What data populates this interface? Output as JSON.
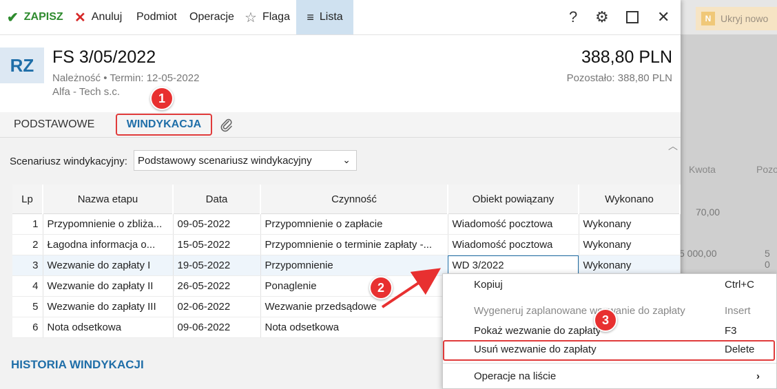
{
  "toolbar": {
    "save": "ZAPISZ",
    "cancel": "Anuluj",
    "podmiot": "Podmiot",
    "operacje": "Operacje",
    "flaga": "Flaga",
    "lista": "Lista"
  },
  "header": {
    "badge": "RZ",
    "title": "FS 3/05/2022",
    "subtitle": "Należność  •  Termin: 12-05-2022",
    "contractor": "Alfa - Tech s.c.",
    "amount": "388,80 PLN",
    "remaining": "Pozostało: 388,80 PLN"
  },
  "tabs": {
    "basic": "PODSTAWOWE",
    "windykacja": "WINDYKACJA"
  },
  "scenario": {
    "label": "Scenariusz windykacyjny:",
    "value": "Podstawowy scenariusz windykacyjny"
  },
  "table": {
    "headers": [
      "Lp",
      "Nazwa etapu",
      "Data",
      "Czynność",
      "Obiekt powiązany",
      "Wykonano"
    ],
    "rows": [
      [
        "1",
        "Przypomnienie o zbliża...",
        "09-05-2022",
        "Przypomnienie o zapłacie",
        "Wiadomość pocztowa",
        "Wykonany"
      ],
      [
        "2",
        "Łagodna informacja o...",
        "15-05-2022",
        "Przypomnienie o terminie zapłaty -...",
        "Wiadomość pocztowa",
        "Wykonany"
      ],
      [
        "3",
        "Wezwanie do zapłaty I",
        "19-05-2022",
        "Przypomnienie",
        "WD 3/2022",
        "Wykonany"
      ],
      [
        "4",
        "Wezwanie do zapłaty II",
        "26-05-2022",
        "Ponaglenie",
        "",
        ""
      ],
      [
        "5",
        "Wezwanie do zapłaty III",
        "02-06-2022",
        "Wezwanie przedsądowe",
        "",
        ""
      ],
      [
        "6",
        "Nota odsetkowa",
        "09-06-2022",
        "Nota odsetkowa",
        "",
        ""
      ]
    ]
  },
  "history_title": "HISTORIA WINDYKACJI",
  "context_menu": [
    {
      "label": "Kopiuj",
      "shortcut": "Ctrl+C",
      "enabled": true
    },
    {
      "label": "Wygeneruj zaplanowane wezwanie do zapłaty",
      "shortcut": "Insert",
      "enabled": false
    },
    {
      "label": "Pokaż wezwanie do zapłaty",
      "shortcut": "F3",
      "enabled": true
    },
    {
      "label": "Usuń wezwanie do zapłaty",
      "shortcut": "Delete",
      "enabled": true
    },
    {
      "label": "Operacje na liście",
      "shortcut": "›",
      "enabled": true
    }
  ],
  "background": {
    "button": "Ukryj nowo",
    "button_icon": "N",
    "col_kwota": "Kwota",
    "col_poz": "Pozo",
    "v1": "70,00",
    "v2": "5 000,00",
    "v3": "5 0"
  },
  "callouts": [
    "1",
    "2",
    "3"
  ],
  "colors": {
    "accent": "#1f6ea8",
    "callout": "#e83030",
    "save": "#2e8b2e"
  }
}
